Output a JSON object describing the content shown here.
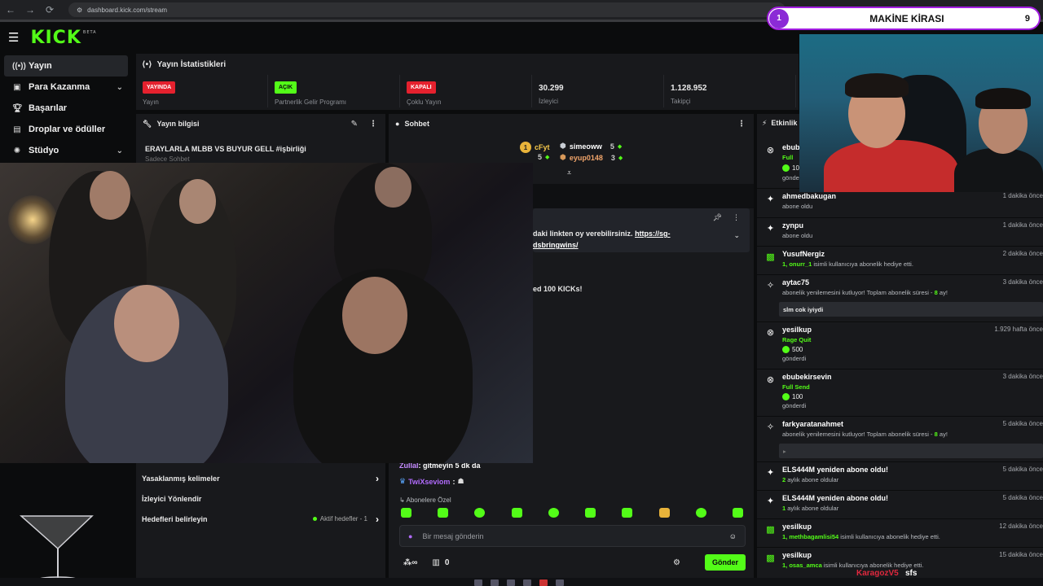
{
  "browser": {
    "url": "dashboard.kick.com/stream"
  },
  "header": {
    "logo": "KICK",
    "logo_tag": "BETA"
  },
  "sidebar": {
    "items": [
      {
        "label": "Yayın",
        "icon": "broadcast-icon"
      },
      {
        "label": "Para Kazanma",
        "icon": "dollar-icon"
      },
      {
        "label": "Başarılar",
        "icon": "trophy-icon"
      },
      {
        "label": "Droplar ve ödüller",
        "icon": "gift-icon"
      },
      {
        "label": "Stüdyo",
        "icon": "studio-icon"
      }
    ]
  },
  "stats": {
    "title": "Yayın İstatistikleri",
    "items": [
      {
        "badge": "YAYINDA",
        "label": "Yayın"
      },
      {
        "badge": "AÇIK",
        "label": "Partnerlik Gelir Programı"
      },
      {
        "badge": "KAPALI",
        "label": "Çoklu Yayın"
      },
      {
        "value": "30.299",
        "label": "İzleyici"
      },
      {
        "value": "1.128.952",
        "label": "Takipçi"
      }
    ]
  },
  "info_panel": {
    "title": "Yayın bilgisi",
    "stream_title": "ERAYLARLA MLBB VS BUYUR GELL #işbirliği",
    "sub": "Sadece Sohbet"
  },
  "goals": {
    "rows": [
      {
        "label": "Yasaklanmış kelimeler"
      },
      {
        "label": "İzleyici Yönlendir"
      },
      {
        "label": "Hedefleri belirleyin",
        "meta": "Aktif hedefler - 1"
      }
    ]
  },
  "chat": {
    "title": "Sohbet",
    "leaderboard": [
      {
        "user": "cFyt",
        "count": "5"
      },
      {
        "user": "simeoww",
        "count": "5"
      },
      {
        "user": "eyup0148",
        "count": "3"
      }
    ],
    "pinned": {
      "line1": "daki linkten oy verebilirsiniz.",
      "link1": "https://sg-",
      "link2": "dsbringwins/"
    },
    "event_text": "ed 100 KICKs!",
    "messages": [
      {
        "user": "Zullal",
        "text": "gitmeyin 5 dk da",
        "color": "#53fc18"
      },
      {
        "user": "TwiXseviom",
        "text": "",
        "color": "#b26bff"
      }
    ],
    "emote_section": "Abonelere Özel",
    "input_placeholder": "Bir mesaj gönderin",
    "viewer_count": "0",
    "send_label": "Gönder"
  },
  "activity": {
    "title": "Etkinlik",
    "items": [
      {
        "name": "ebube",
        "desc_green": "Full",
        "amount": "100",
        "desc": "gönderdi",
        "time": ""
      },
      {
        "name": "ahmedbakugan",
        "desc": "abone oldu",
        "time": "1 dakika önce"
      },
      {
        "name": "zynpu",
        "desc": "abone oldu",
        "time": "1 dakika önce"
      },
      {
        "name": "YusufNergiz",
        "desc_green": "1, onurr_1",
        "desc": "isimli kullanıcıya abonelik hediye etti.",
        "time": "2 dakika önce"
      },
      {
        "name": "aytac75",
        "desc": "abonelik yenilemesini kutluyor! Toplam abonelik süresi -",
        "desc_green2": "8",
        "desc_tail": "ay!",
        "box": "slm cok iyiydi",
        "time": "3 dakika önce"
      },
      {
        "name": "yesilkup",
        "desc_green": "Rage Quit",
        "amount": "500",
        "desc": "gönderdi",
        "time": "1.929 hafta önce"
      },
      {
        "name": "ebubekirsevin",
        "desc_green": "Full Send",
        "amount": "100",
        "desc": "gönderdi",
        "time": "3 dakika önce"
      },
      {
        "name": "farkyaratanahmet",
        "desc": "abonelik yenilemesini kutluyor! Toplam abonelik süresi -",
        "desc_green2": "8",
        "desc_tail": "ay!",
        "time": "5 dakika önce"
      },
      {
        "name": "ELS444M yeniden abone oldu!",
        "desc_green": "2",
        "desc": "aylık abone oldular",
        "time": "5 dakika önce"
      },
      {
        "name": "ELS444M yeniden abone oldu!",
        "desc_green": "1",
        "desc": "aylık abone oldular",
        "time": "5 dakika önce"
      },
      {
        "name": "yesilkup",
        "desc_green": "1, methbagamlisi54",
        "desc": "isimli kullanıcıya abonelik hediye etti.",
        "time": "12 dakika önce"
      },
      {
        "name": "yesilkup",
        "desc_green": "1, osas_amca",
        "desc": "isimli kullanıcıya abonelik hediye etti.",
        "time": "15 dakika önce"
      }
    ]
  },
  "widget": {
    "left_num": "1",
    "title": "MAKİNE KİRASI",
    "right_num": "9"
  },
  "taskbar": {
    "user": "KaragozV5",
    "text": "sfs"
  },
  "colors": {
    "brand": "#53fc18",
    "live_red": "#e5212e",
    "panel": "#18191c",
    "widget_purple": "#a21de0"
  }
}
